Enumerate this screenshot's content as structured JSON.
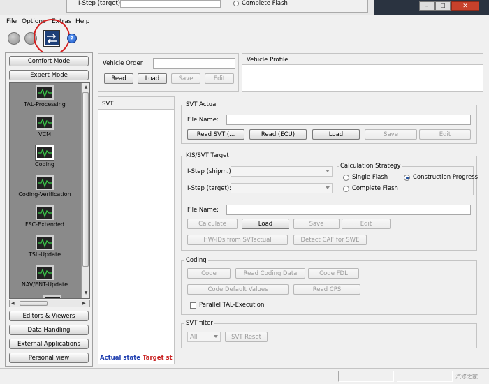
{
  "background_window": {
    "istep_target_label": "I-Step (target):",
    "complete_flash_label": "Complete Flash"
  },
  "menu": [
    "File",
    "Options",
    "Extras",
    "Help"
  ],
  "toolbar": {
    "icons": [
      "back-icon",
      "forward-icon",
      "swap-icon",
      "help-icon"
    ]
  },
  "sidebar": {
    "mode_buttons": [
      "Comfort Mode",
      "Expert Mode"
    ],
    "modules": [
      "TAL-Processing",
      "VCM",
      "Coding",
      "Coding-Verification",
      "FSC-Extended",
      "TSL-Update",
      "NAV/ENT-Update"
    ],
    "selected_module": "Coding",
    "bottom_buttons": [
      "Editors & Viewers",
      "Data Handling",
      "External Applications",
      "Personal view"
    ]
  },
  "vehicle_order": {
    "label": "Vehicle Order",
    "value": "",
    "buttons": [
      "Read",
      "Load",
      "Save",
      "Edit"
    ]
  },
  "vehicle_profile": {
    "title": "Vehicle Profile"
  },
  "svt_panel": {
    "title": "SVT",
    "actual_state": "Actual state",
    "target_state": "Target st"
  },
  "svt_actual": {
    "title": "SVT Actual",
    "file_name_label": "File Name:",
    "file_name_value": "",
    "buttons": [
      "Read SVT (...",
      "Read (ECU)",
      "Load",
      "Save",
      "Edit"
    ]
  },
  "kis_target": {
    "title": "KIS/SVT Target",
    "istep_shipm_label": "I-Step (shipm.):",
    "istep_target_label": "I-Step (target):",
    "strategy_title": "Calculation Strategy",
    "strategy_options": [
      "Single Flash",
      "Complete Flash",
      "Construction Progress"
    ],
    "strategy_selected": "Construction Progress",
    "file_name_label": "File Name:",
    "file_name_value": "",
    "buttons": [
      "Calculate",
      "Load",
      "Save",
      "Edit"
    ],
    "extra_buttons": [
      "HW-IDs from SVTactual",
      "Detect CAF for SWE"
    ]
  },
  "coding": {
    "title": "Coding",
    "buttons": [
      "Code",
      "Read Coding Data",
      "Code FDL",
      "Code Default Values",
      "Read CPS"
    ],
    "parallel_label": "Parallel TAL-Execution",
    "parallel_checked": false
  },
  "svt_filter": {
    "title": "SVT filter",
    "select_value": "All",
    "reset_label": "SVT Reset"
  },
  "watermark": "汽修之家"
}
